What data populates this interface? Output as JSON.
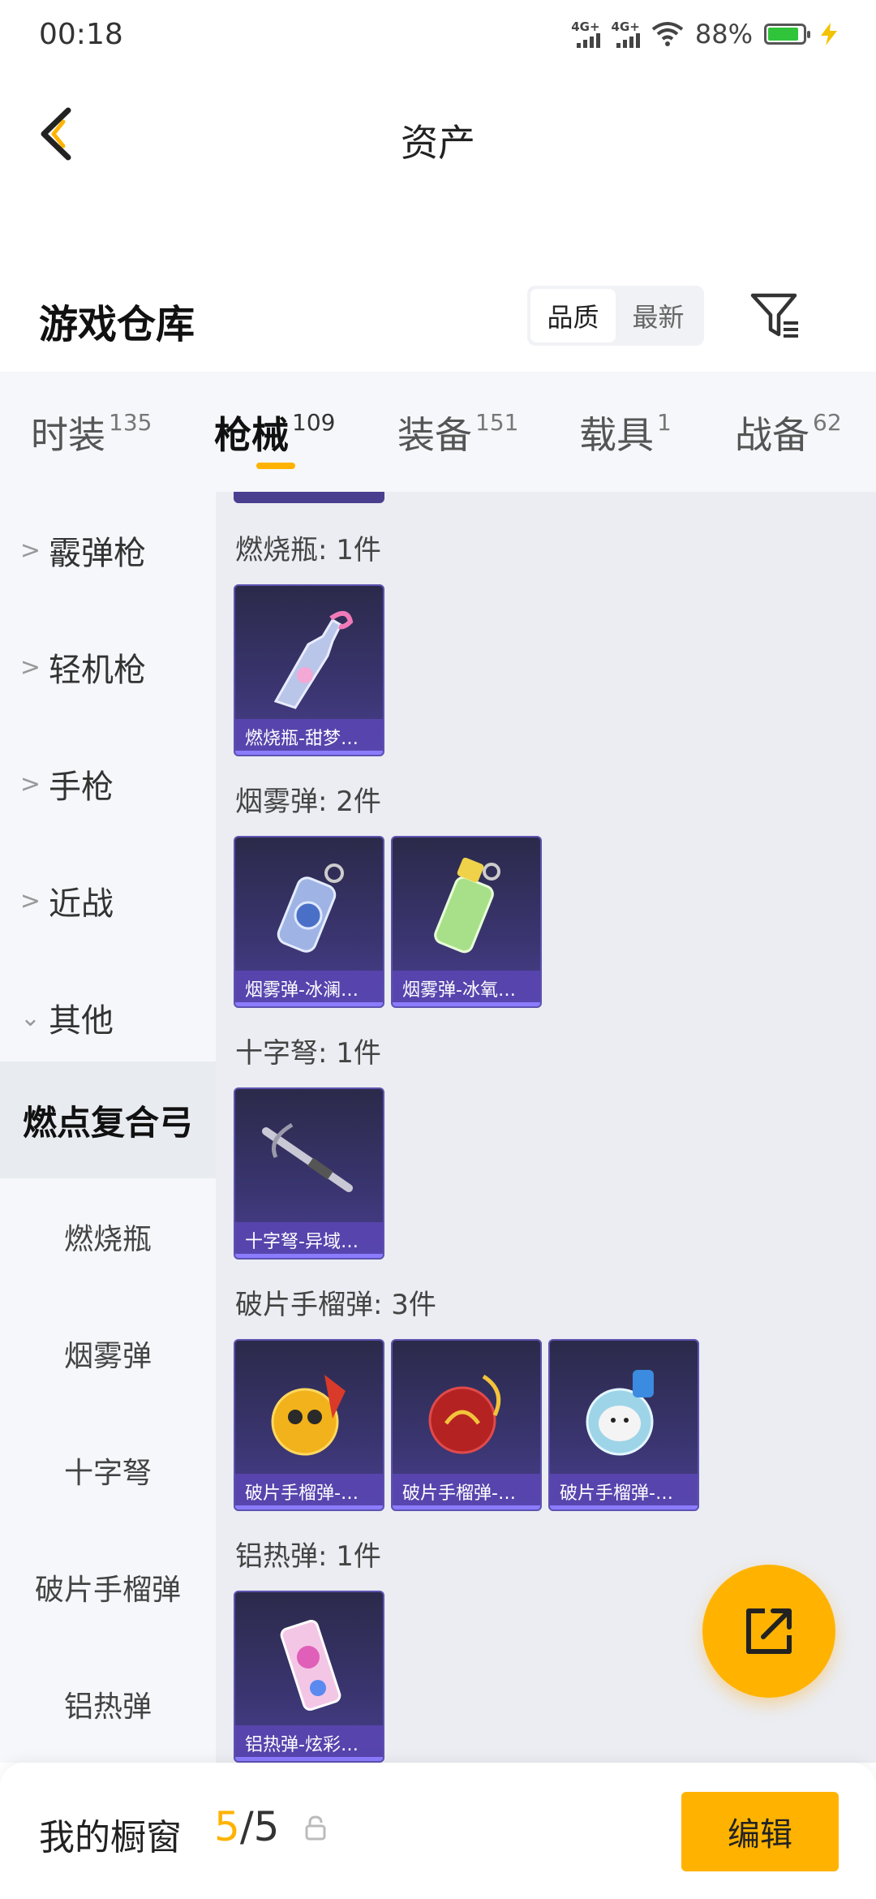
{
  "status_bar": {
    "time": "00:18",
    "network1": "4G+",
    "network2": "4G+",
    "battery": "88%",
    "battery_level": 0.88
  },
  "header": {
    "title": "资产"
  },
  "warehouse": {
    "title": "游戏仓库",
    "sort_quality": "品质",
    "sort_newest": "最新"
  },
  "tabs": [
    {
      "label": "时装",
      "count": "135"
    },
    {
      "label": "枪械",
      "count": "109"
    },
    {
      "label": "装备",
      "count": "151"
    },
    {
      "label": "载具",
      "count": "1"
    },
    {
      "label": "战备",
      "count": "62"
    }
  ],
  "sidebar": {
    "items": [
      {
        "label": "霰弹枪"
      },
      {
        "label": "轻机枪"
      },
      {
        "label": "手枪"
      },
      {
        "label": "近战"
      },
      {
        "label": "其他"
      },
      {
        "label": "燃点复合弓"
      },
      {
        "label": "燃烧瓶"
      },
      {
        "label": "烟雾弹"
      },
      {
        "label": "十字弩"
      },
      {
        "label": "破片手榴弹"
      },
      {
        "label": "铝热弹"
      }
    ]
  },
  "sections": [
    {
      "title": "燃烧瓶: 1件",
      "items": [
        "燃烧瓶-甜梦…"
      ]
    },
    {
      "title": "烟雾弹: 2件",
      "items": [
        "烟雾弹-冰澜…",
        "烟雾弹-冰氧…"
      ]
    },
    {
      "title": "十字弩: 1件",
      "items": [
        "十字弩-异域…"
      ]
    },
    {
      "title": "破片手榴弹: 3件",
      "items": [
        "破片手榴弹-…",
        "破片手榴弹-…",
        "破片手榴弹-…"
      ]
    },
    {
      "title": "铝热弹: 1件",
      "items": [
        "铝热弹-炫彩…"
      ]
    }
  ],
  "showcase": {
    "title": "我的橱窗",
    "current": "5",
    "separator": "/",
    "total": "5",
    "edit_label": "编辑"
  },
  "colors": {
    "accent": "#ffb300",
    "card_bg": "#3a3570",
    "card_label": "#5a46b4"
  }
}
